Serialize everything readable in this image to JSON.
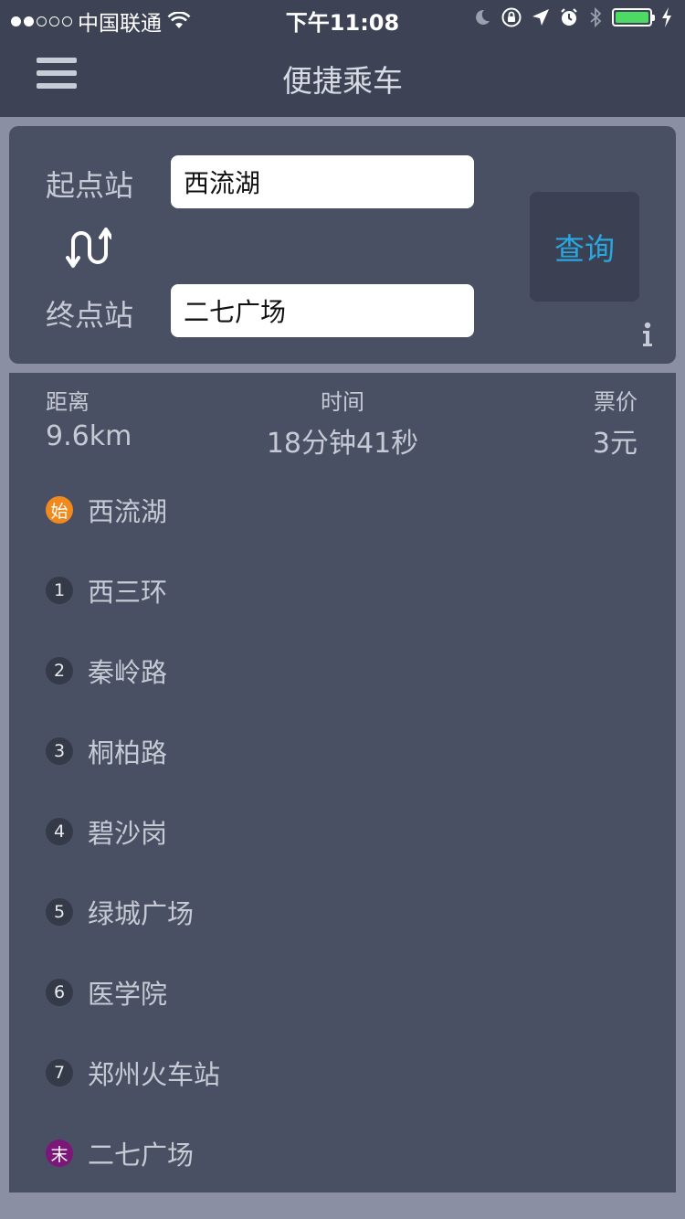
{
  "status_bar": {
    "carrier": "中国联通",
    "time": "下午11:08"
  },
  "nav": {
    "title": "便捷乘车"
  },
  "search": {
    "origin_label": "起点站",
    "origin_value": "西流湖",
    "destination_label": "终点站",
    "destination_value": "二七广场",
    "query_label": "查询"
  },
  "summary": {
    "distance_label": "距离",
    "distance_value": "9.6km",
    "time_label": "时间",
    "time_value": "18分钟41秒",
    "fare_label": "票价",
    "fare_value": "3元"
  },
  "stops": [
    {
      "badge": "始",
      "name": "西流湖"
    },
    {
      "badge": "1",
      "name": "西三环"
    },
    {
      "badge": "2",
      "name": "秦岭路"
    },
    {
      "badge": "3",
      "name": "桐柏路"
    },
    {
      "badge": "4",
      "name": "碧沙岗"
    },
    {
      "badge": "5",
      "name": "绿城广场"
    },
    {
      "badge": "6",
      "name": "医学院"
    },
    {
      "badge": "7",
      "name": "郑州火车站"
    },
    {
      "badge": "末",
      "name": "二七广场"
    }
  ],
  "colors": {
    "nav_bg": "#3d4354",
    "card_bg": "#4a5063",
    "page_bg": "#8a8fa3",
    "accent": "#29a8e0",
    "start_badge": "#f08a1c",
    "end_badge": "#7b1778",
    "battery": "#4cd964"
  },
  "icons": {
    "menu": "hamburger-icon",
    "swap": "swap-arrows-icon",
    "info": "info-icon"
  }
}
